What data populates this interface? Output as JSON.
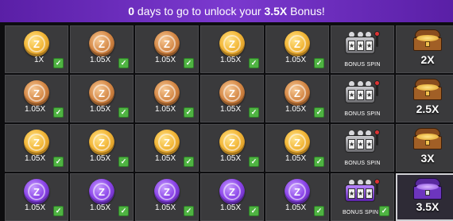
{
  "banner": {
    "days": "0",
    "text_a": " days to go to unlock your ",
    "bonus": "3.5X",
    "text_b": " Bonus!"
  },
  "colors": {
    "banner_purple": "#6a2bbd",
    "cell_bg": "#3a3a3c",
    "check_green": "#4fb342"
  },
  "rows": [
    {
      "days": [
        {
          "coin": "gold",
          "multiplier": "1X",
          "checked": true
        },
        {
          "coin": "bronze",
          "multiplier": "1.05X",
          "checked": true
        },
        {
          "coin": "bronze",
          "multiplier": "1.05X",
          "checked": true
        },
        {
          "coin": "gold",
          "multiplier": "1.05X",
          "checked": true
        },
        {
          "coin": "gold",
          "multiplier": "1.05X",
          "checked": true
        }
      ],
      "bonus_spin": "BONUS SPIN",
      "reward": "2X"
    },
    {
      "days": [
        {
          "coin": "bronze",
          "multiplier": "1.05X",
          "checked": true
        },
        {
          "coin": "bronze",
          "multiplier": "1.05X",
          "checked": true
        },
        {
          "coin": "bronze",
          "multiplier": "1.05X",
          "checked": true
        },
        {
          "coin": "bronze",
          "multiplier": "1.05X",
          "checked": true
        },
        {
          "coin": "bronze",
          "multiplier": "1.05X",
          "checked": true
        }
      ],
      "bonus_spin": "BONUS SPIN",
      "reward": "2.5X"
    },
    {
      "days": [
        {
          "coin": "gold",
          "multiplier": "1.05X",
          "checked": true
        },
        {
          "coin": "gold",
          "multiplier": "1.05X",
          "checked": true
        },
        {
          "coin": "gold",
          "multiplier": "1.05X",
          "checked": true
        },
        {
          "coin": "gold",
          "multiplier": "1.05X",
          "checked": true
        },
        {
          "coin": "gold",
          "multiplier": "1.05X",
          "checked": true
        }
      ],
      "bonus_spin": "BONUS SPIN",
      "reward": "3X"
    },
    {
      "days": [
        {
          "coin": "purple",
          "multiplier": "1.05X",
          "checked": true
        },
        {
          "coin": "purple",
          "multiplier": "1.05X",
          "checked": true
        },
        {
          "coin": "purple",
          "multiplier": "1.05X",
          "checked": true
        },
        {
          "coin": "purple",
          "multiplier": "1.05X",
          "checked": true
        },
        {
          "coin": "purple",
          "multiplier": "1.05X",
          "checked": true
        }
      ],
      "bonus_spin": "BONUS SPIN",
      "reward": "3.5X",
      "active": true
    }
  ],
  "icons": {
    "coin": "z-coin-icon",
    "slot": "slot-machine-icon",
    "chest": "treasure-chest-icon",
    "check": "checkmark-icon"
  }
}
